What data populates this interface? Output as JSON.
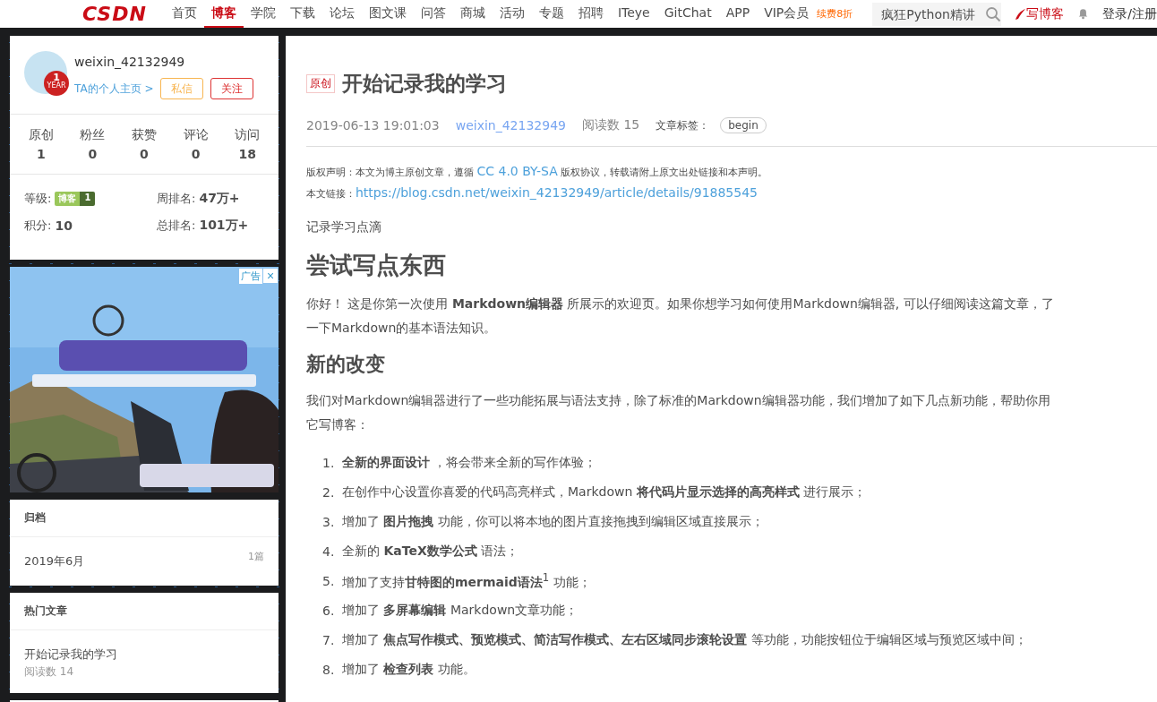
{
  "nav": {
    "logo": "CSDN",
    "items": [
      {
        "label": "首页",
        "selected": false
      },
      {
        "label": "博客",
        "selected": true
      },
      {
        "label": "学院",
        "selected": false
      },
      {
        "label": "下载",
        "selected": false
      },
      {
        "label": "论坛",
        "selected": false
      },
      {
        "label": "图文课",
        "selected": false
      },
      {
        "label": "问答",
        "selected": false
      },
      {
        "label": "商城",
        "selected": false
      },
      {
        "label": "活动",
        "selected": false
      },
      {
        "label": "专题",
        "selected": false
      },
      {
        "label": "招聘",
        "selected": false
      },
      {
        "label": "ITeye",
        "selected": false
      },
      {
        "label": "GitChat",
        "selected": false
      },
      {
        "label": "APP",
        "selected": false
      }
    ],
    "vip": {
      "label": "VIP会员",
      "badge": "续费8折"
    },
    "search": {
      "placeholder": "疯狂Python精讲"
    },
    "write": "写博客",
    "login": "登录/注册"
  },
  "profile": {
    "name": "weixin_42132949",
    "badge": {
      "number": "1",
      "unit": "YEAR"
    },
    "homepage": "TA的个人主页 >",
    "message": "私信",
    "follow": "关注",
    "stats": [
      {
        "label": "原创",
        "value": "1"
      },
      {
        "label": "粉丝",
        "value": "0"
      },
      {
        "label": "获赞",
        "value": "0"
      },
      {
        "label": "评论",
        "value": "0"
      },
      {
        "label": "访问",
        "value": "18"
      }
    ],
    "level_label": "等级:",
    "level_tag": "博客",
    "level_num": "1",
    "week_rank_label": "周排名:",
    "week_rank": "47万+",
    "points_label": "积分:",
    "points": "10",
    "total_rank_label": "总排名:",
    "total_rank": "101万+"
  },
  "ad": {
    "kind": "picture",
    "label": "广告",
    "close": "×"
  },
  "archive": {
    "title": "归档",
    "items": [
      {
        "month": "2019年6月",
        "count": "1篇"
      }
    ]
  },
  "hot": {
    "title": "热门文章",
    "items": [
      {
        "title": "开始记录我的学习",
        "reads": "阅读数 14"
      }
    ]
  },
  "article": {
    "tag": "原创",
    "title": "开始记录我的学习",
    "date": "2019-06-13 19:01:03",
    "author": "weixin_42132949",
    "reads": "阅读数 15",
    "tags_label": "文章标签：",
    "tags": [
      "begin"
    ],
    "copyright": {
      "before": "版权声明：本文为博主原创文章，遵循",
      "license": "CC 4.0 BY-SA",
      "after": "版权协议，转载请附上原文出处链接和本声明。"
    },
    "link_label": "本文链接：",
    "link": "https://blog.csdn.net/weixin_42132949/article/details/91885545",
    "blocks": [
      {
        "kind": "p",
        "lines": [
          "记录学习点滴"
        ]
      },
      {
        "kind": "h2",
        "text": "尝试写点东西"
      },
      {
        "kind": "p",
        "lines": [
          "你好！ 这是你第一次使用 **Markdown编辑器** 所展示的欢迎页。如果你想学习如何使用Markdown编辑器, 可以仔细阅读这篇文章，了",
          "一下Markdown的基本语法知识。"
        ]
      },
      {
        "kind": "h3",
        "text": "新的改变"
      },
      {
        "kind": "p",
        "lines": [
          "我们对Markdown编辑器进行了一些功能拓展与语法支持，除了标准的Markdown编辑器功能，我们增加了如下几点新功能，帮助你用",
          "它写博客："
        ]
      },
      {
        "kind": "ol",
        "items": [
          {
            "num": "1.",
            "text": "**全新的界面设计** ，将会带来全新的写作体验；"
          },
          {
            "num": "2.",
            "text": "在创作中心设置你喜爱的代码高亮样式，Markdown **将代码片显示选择的高亮样式** 进行展示；"
          },
          {
            "num": "3.",
            "text": "增加了 **图片拖拽** 功能，你可以将本地的图片直接拖拽到编辑区域直接展示；"
          },
          {
            "num": "4.",
            "text": "全新的 **KaTeX数学公式** 语法；"
          },
          {
            "num": "5.",
            "text": "增加了支持**甘特图的mermaid语法**$^{1}$ 功能；"
          },
          {
            "num": "6.",
            "text": "增加了 **多屏幕编辑** Markdown文章功能；"
          },
          {
            "num": "7.",
            "text": "增加了 **焦点写作模式、预览模式、简洁写作模式、左右区域同步滚轮设置** 等功能，功能按钮位于编辑区域与预览区域中间；"
          },
          {
            "num": "8.",
            "text": "增加了 **检查列表** 功能。"
          }
        ]
      }
    ]
  }
}
